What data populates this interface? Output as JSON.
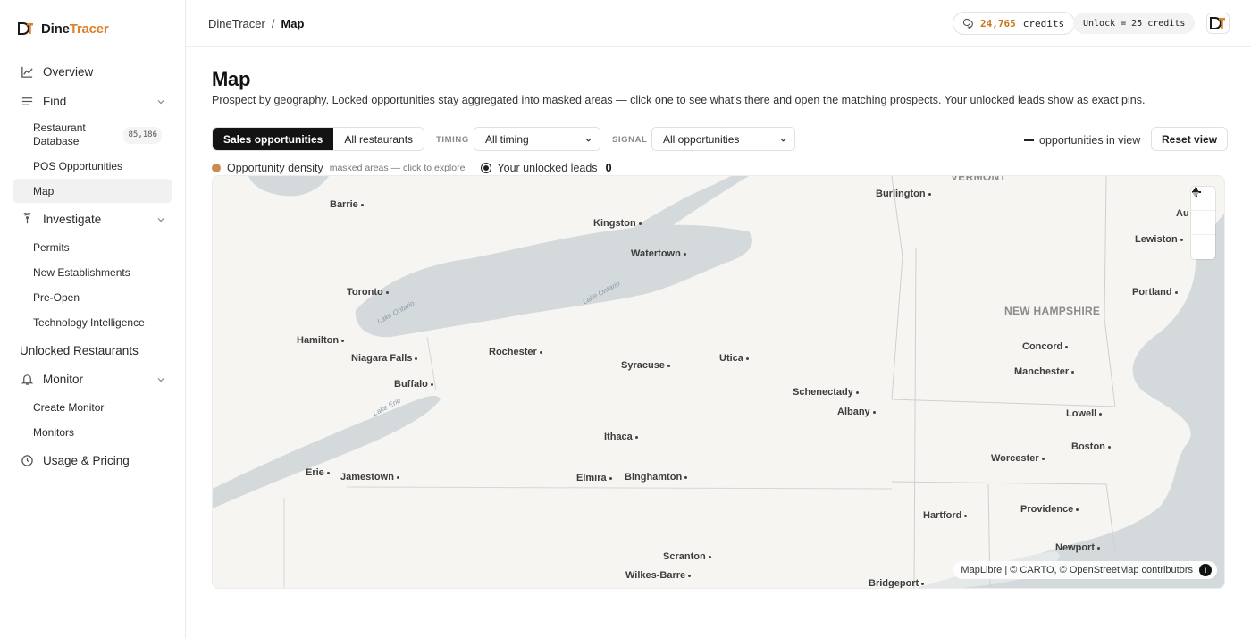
{
  "brand": {
    "part1": "Dine",
    "part2": "Tracer",
    "accent": "#d9822b"
  },
  "sidebar": {
    "overview": "Overview",
    "find": "Find",
    "find_items": [
      {
        "label": "Restaurant Database",
        "count": "85,186"
      },
      {
        "label": "POS Opportunities"
      },
      {
        "label": "Map",
        "active": true
      }
    ],
    "investigate": "Investigate",
    "investigate_items": [
      "Permits",
      "New Establishments",
      "Pre-Open",
      "Technology Intelligence"
    ],
    "unlocked": "Unlocked Restaurants",
    "monitor": "Monitor",
    "monitor_items": [
      "Create Monitor",
      "Monitors"
    ],
    "usage": "Usage & Pricing"
  },
  "topbar": {
    "crumb_root": "DineTracer",
    "crumb_sep": "/",
    "crumb_current": "Map",
    "credits_value": "24,765",
    "credits_label": "credits",
    "unlock_text": "Unlock = 25 credits"
  },
  "page": {
    "title": "Map",
    "subtitle": "Prospect by geography. Locked opportunities stay aggregated into masked areas — click one to see what's there and open the matching prospects. Your unlocked leads show as exact pins."
  },
  "controls": {
    "seg_sales": "Sales opportunities",
    "seg_all": "All restaurants",
    "timing_label": "TIMING",
    "timing_value": "All timing",
    "signal_label": "SIGNAL",
    "signal_value": "All opportunities",
    "opp_in_view": "opportunities in view",
    "reset": "Reset view"
  },
  "legend": {
    "density": "Opportunity density",
    "density_hint": "masked areas — click to explore",
    "unlocked": "Your unlocked leads",
    "unlocked_count": "0"
  },
  "map": {
    "regions": [
      "VERMONT",
      "NEW HAMPSHIRE"
    ],
    "lakes": [
      "Lake Ontario",
      "Lake Ontario",
      "Lake Erie"
    ],
    "cities": [
      "Burlington",
      "Barrie",
      "Kingston",
      "Watertown",
      "Toronto",
      "Hamilton",
      "Niagara Falls",
      "Rochester",
      "Syracuse",
      "Utica",
      "Buffalo",
      "Schenectady",
      "Albany",
      "Ithaca",
      "Erie",
      "Jamestown",
      "Elmira",
      "Binghamton",
      "Scranton",
      "Wilkes-Barre",
      "Bridgeport",
      "Hartford",
      "Providence",
      "Newport",
      "Worcester",
      "Boston",
      "Lowell",
      "Manchester",
      "Concord",
      "Portland",
      "Lewiston",
      "Au"
    ],
    "attribution": {
      "maplibre": "MapLibre",
      "sep": " | © ",
      "carto": "CARTO",
      "comma": ", © ",
      "osm": "OpenStreetMap",
      "contrib": " contributors"
    },
    "water_color": "#d4dadc",
    "land_color": "#f6f5f2"
  }
}
